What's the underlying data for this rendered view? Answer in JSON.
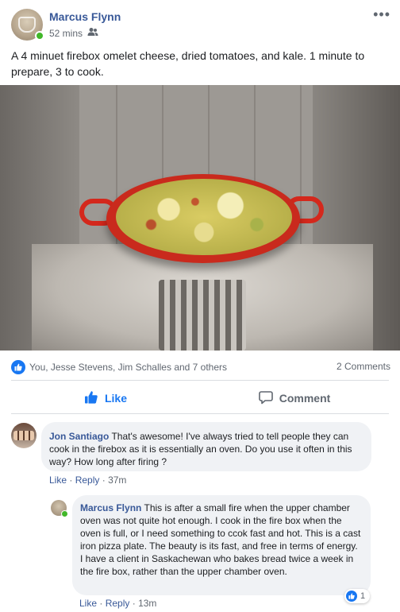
{
  "post": {
    "author": "Marcus Flynn",
    "time": "52 mins",
    "audience_icon": "friends-icon",
    "more_icon": "•••",
    "text": "A 4 minuet firebox omelet cheese, dried tomatoes, and kale. 1 minute to prepare, 3 to cook."
  },
  "reactions": {
    "names": "You, Jesse Stevens, Jim Schalles and 7 others",
    "comment_count": "2 Comments"
  },
  "actions": {
    "like": "Like",
    "comment": "Comment"
  },
  "comments": [
    {
      "author": "Jon Santiago",
      "text": "That's awesome! I've always tried to tell people they can cook in the firebox as it is essentially an oven. Do you use it often in this way? How long after firing ?",
      "like": "Like",
      "reply": "Reply",
      "time": "37m"
    },
    {
      "author": "Marcus Flynn",
      "text": "This is after a small fire when the upper chamber oven was not quite hot enough. I cook in the fire box when the oven is full, or I need something to ccok fast and hot. This is a cast iron pizza plate. The beauty is its fast, and free in terms of energy. I have a client in Saskachewan who bakes bread twice a week in the fire box, rather than the upper chamber oven.",
      "reaction_count": "1",
      "like": "Like",
      "reply": "Reply",
      "time": "13m"
    }
  ],
  "colors": {
    "brand_blue": "#1877f2",
    "name_blue": "#385898",
    "online_green": "#42b72a",
    "muted_text": "#606770",
    "bubble_bg": "#f0f2f5"
  }
}
